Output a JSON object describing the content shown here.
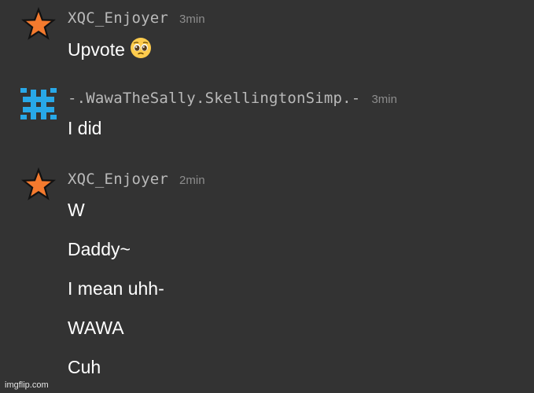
{
  "messages": [
    {
      "username": "XQC_Enjoyer",
      "time": "3min",
      "avatar": "orange-star-icon",
      "lines": [
        "Upvote"
      ],
      "emoji": "pleading-face-emoji"
    },
    {
      "username": "-.WawaTheSally.SkellingtonSimp.-",
      "time": "3min",
      "avatar": "blue-hash-icon",
      "lines": [
        "I did"
      ]
    },
    {
      "username": "XQC_Enjoyer",
      "time": "2min",
      "avatar": "orange-star-icon",
      "lines": [
        "W",
        "Daddy~",
        "I mean uhh-",
        "WAWA",
        "Cuh"
      ]
    }
  ],
  "colors": {
    "background": "#333333",
    "star_fill": "#f47a2e",
    "hash_fill": "#28a8e8",
    "username": "#b9b9b9",
    "time": "#8d8d8d",
    "text": "#ffffff"
  },
  "watermark": "imgflip.com"
}
